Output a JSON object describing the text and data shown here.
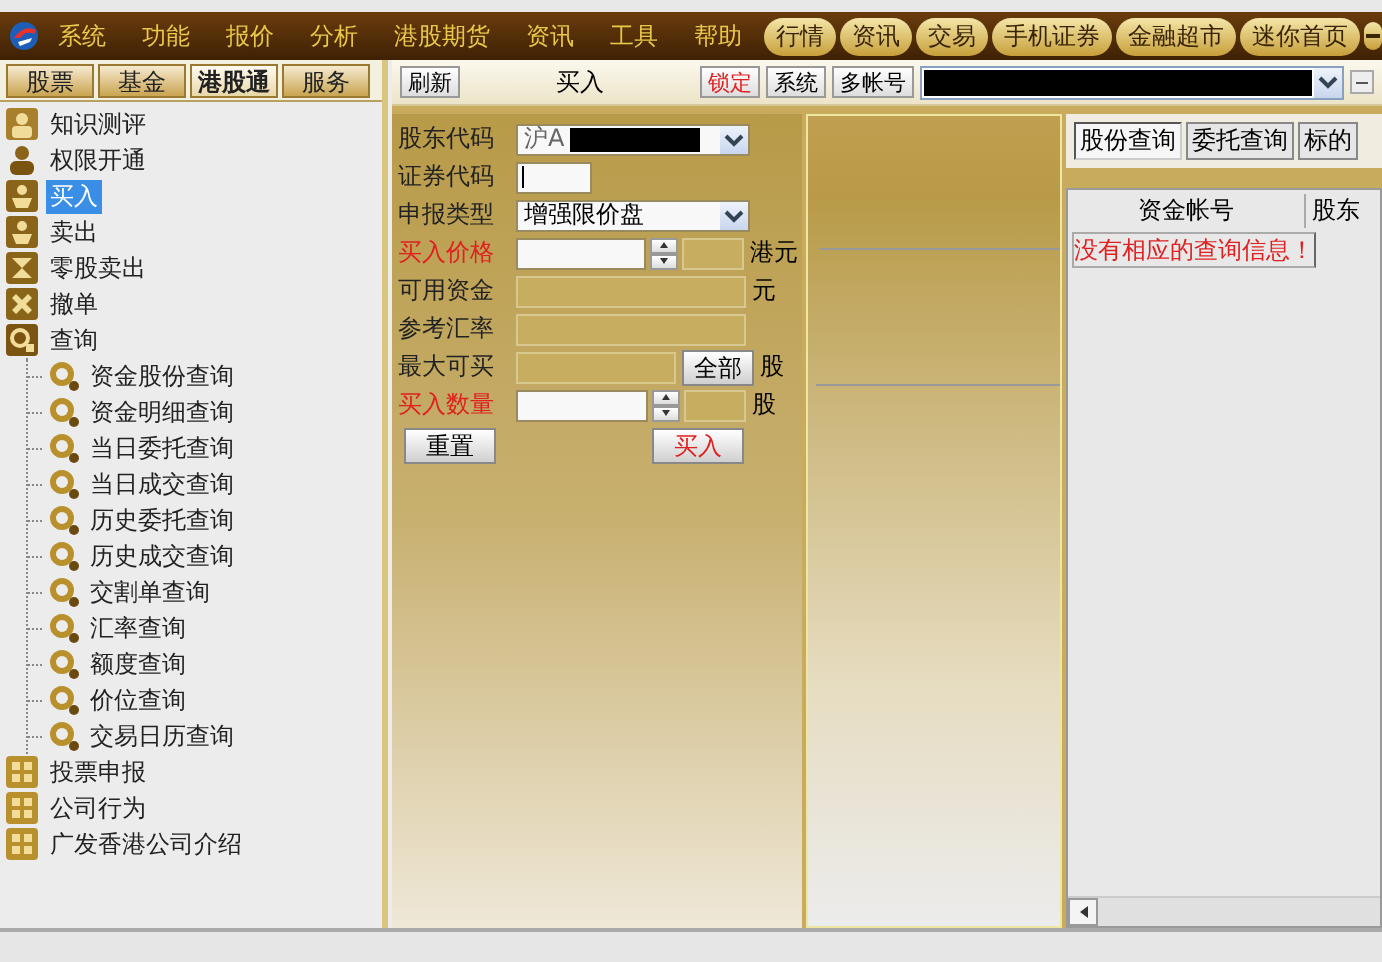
{
  "menu": {
    "items": [
      "系统",
      "功能",
      "报价",
      "分析",
      "港股期货",
      "资讯",
      "工具",
      "帮助"
    ]
  },
  "top_buttons": [
    "行情",
    "资讯",
    "交易",
    "手机证券",
    "金融超市",
    "迷你首页"
  ],
  "side_tabs": [
    {
      "label": "股票",
      "selected": false
    },
    {
      "label": "基金",
      "selected": false
    },
    {
      "label": "港股通",
      "selected": true
    },
    {
      "label": "服务",
      "selected": false
    }
  ],
  "tree": [
    {
      "label": "知识测评",
      "kind": "user",
      "selected": false
    },
    {
      "label": "权限开通",
      "kind": "person",
      "selected": false
    },
    {
      "label": "买入",
      "kind": "trade",
      "selected": true
    },
    {
      "label": "卖出",
      "kind": "trade",
      "selected": false
    },
    {
      "label": "零股卖出",
      "kind": "split",
      "selected": false
    },
    {
      "label": "撤单",
      "kind": "cancel",
      "selected": false
    },
    {
      "label": "查询",
      "kind": "query",
      "selected": false,
      "expanded": true,
      "children": [
        {
          "label": "资金股份查询",
          "selected": false
        },
        {
          "label": "资金明细查询",
          "selected": false
        },
        {
          "label": "当日委托查询",
          "selected": false
        },
        {
          "label": "当日成交查询",
          "selected": false
        },
        {
          "label": "历史委托查询",
          "selected": false
        },
        {
          "label": "历史成交查询",
          "selected": false
        },
        {
          "label": "交割单查询",
          "selected": false
        },
        {
          "label": "汇率查询",
          "selected": false
        },
        {
          "label": "额度查询",
          "selected": false
        },
        {
          "label": "价位查询",
          "selected": false
        },
        {
          "label": "交易日历查询",
          "selected": false
        }
      ]
    },
    {
      "label": "投票申报",
      "kind": "module",
      "selected": false
    },
    {
      "label": "公司行为",
      "kind": "module",
      "selected": false
    },
    {
      "label": "广发香港公司介绍",
      "kind": "module",
      "selected": false
    }
  ],
  "toolbar": {
    "refresh": "刷新",
    "title": "买入",
    "buttons": [
      {
        "label": "锁定",
        "kind": "alert"
      },
      {
        "label": "系统",
        "kind": "plain"
      },
      {
        "label": "多帐号",
        "kind": "plain"
      }
    ]
  },
  "form": {
    "fields": [
      {
        "label": "股东代码",
        "kind": "combo",
        "required": false,
        "value": "沪A"
      },
      {
        "label": "证券代码",
        "kind": "text",
        "required": false
      },
      {
        "label": "申报类型",
        "kind": "select",
        "required": false,
        "value": "增强限价盘"
      },
      {
        "label": "买入价格",
        "kind": "spin",
        "required": true,
        "unit": "港元"
      },
      {
        "label": "可用资金",
        "kind": "readonly",
        "required": false,
        "unit": "元"
      },
      {
        "label": "参考汇率",
        "kind": "readonly",
        "required": false
      },
      {
        "label": "最大可买",
        "kind": "readonly_button",
        "required": false,
        "button": "全部",
        "unit": "股"
      },
      {
        "label": "买入数量",
        "kind": "spin",
        "required": true,
        "unit": "股"
      }
    ],
    "buttons": [
      {
        "label": "重置",
        "kind": "plain"
      },
      {
        "label": "买入",
        "kind": "submit"
      }
    ]
  },
  "query": {
    "tabs": [
      {
        "label": "股份查询",
        "selected": true
      },
      {
        "label": "委托查询",
        "selected": false
      },
      {
        "label": "标的",
        "selected": false
      }
    ],
    "table": {
      "columns": [
        "资金帐号",
        "股东"
      ],
      "message": "没有相应的查询信息！"
    }
  }
}
